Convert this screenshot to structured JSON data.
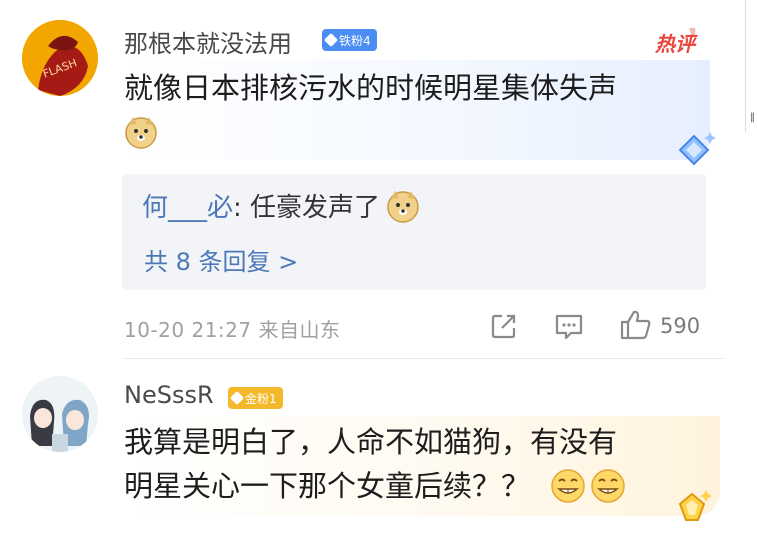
{
  "comments": [
    {
      "username": "那根本就没法用",
      "badge": "铁粉4",
      "hot_tag": "热评",
      "text": "就像日本排核污水的时候明星集体失声",
      "reply": {
        "author": "何___必",
        "text": ": 任豪发声了"
      },
      "reply_more": "共 8 条回复 >",
      "meta": "10-20 21:27 来自山东",
      "likes": "590"
    },
    {
      "username": "NeSssR",
      "badge": "金粉1",
      "text_line1": "我算是明白了，人命不如猫狗，有没有",
      "text_line2": "明星关心一下那个女童后续？？"
    }
  ],
  "avatar1_text": "FLASH",
  "edge_mark": "‖",
  "colors": {
    "link": "#4c78b8",
    "badge_blue": "#4a8ef5",
    "badge_gold": "#f5b82b",
    "hot": "#e8463d"
  }
}
